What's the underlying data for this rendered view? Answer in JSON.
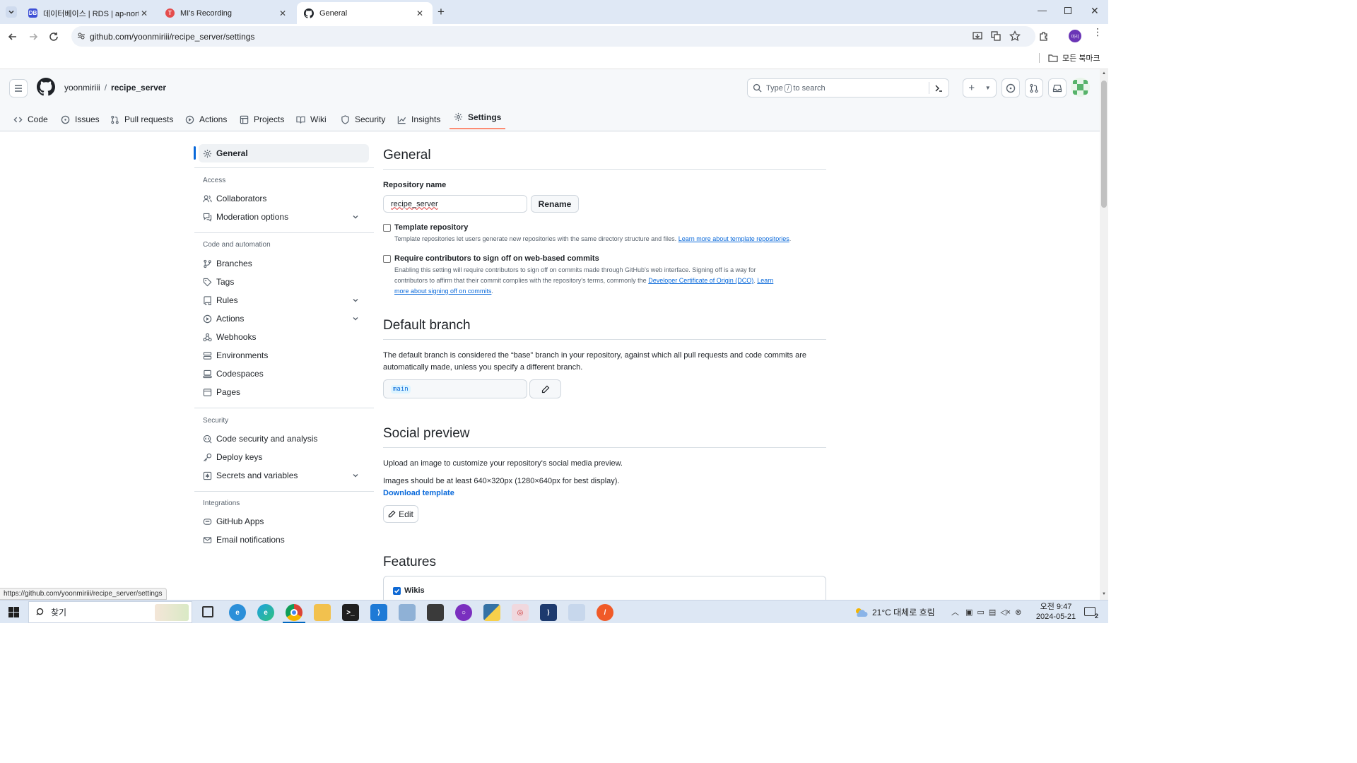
{
  "browser": {
    "tabs": [
      {
        "title": "데이터베이스 | RDS | ap-northeast",
        "active": false
      },
      {
        "title": "MI's Recording",
        "active": false
      },
      {
        "title": "General",
        "active": true
      }
    ],
    "url": "github.com/yoonmiriii/recipe_server/settings",
    "bookmarks_label": "모든 북마크",
    "profile_initials": "미리"
  },
  "github": {
    "owner": "yoonmiriii",
    "separator": "/",
    "repo": "recipe_server",
    "search_placeholder_pre": "Type",
    "search_key": "/",
    "search_placeholder_post": "to search",
    "repo_tabs": [
      "Code",
      "Issues",
      "Pull requests",
      "Actions",
      "Projects",
      "Wiki",
      "Security",
      "Insights",
      "Settings"
    ],
    "selected_tab": "Settings"
  },
  "sidebar": {
    "general": "General",
    "access_heading": "Access",
    "access_items": [
      "Collaborators",
      "Moderation options"
    ],
    "code_heading": "Code and automation",
    "code_items": [
      "Branches",
      "Tags",
      "Rules",
      "Actions",
      "Webhooks",
      "Environments",
      "Codespaces",
      "Pages"
    ],
    "security_heading": "Security",
    "security_items": [
      "Code security and analysis",
      "Deploy keys",
      "Secrets and variables"
    ],
    "integrations_heading": "Integrations",
    "integrations_items": [
      "GitHub Apps",
      "Email notifications"
    ]
  },
  "general": {
    "title": "General",
    "repo_name_label": "Repository name",
    "repo_name_value": "recipe_server",
    "rename_button": "Rename",
    "template_label": "Template repository",
    "template_note": "Template repositories let users generate new repositories with the same directory structure and files.",
    "template_link": "Learn more about template repositories",
    "signoff_label": "Require contributors to sign off on web-based commits",
    "signoff_note_1": "Enabling this setting will require contributors to sign off on commits made through GitHub's web interface. Signing off is a way for",
    "signoff_note_2": "contributors to affirm that their commit complies with the repository's terms, commonly the",
    "signoff_link_1": "Developer Certificate of Origin (DCO)",
    "signoff_link_2a": "Learn",
    "signoff_link_2b": "more about signing off on commits"
  },
  "default_branch": {
    "title": "Default branch",
    "desc_1": "The default branch is considered the “base” branch in your repository, against which all pull requests and code commits are",
    "desc_2": "automatically made, unless you specify a different branch.",
    "branch": "main"
  },
  "social_preview": {
    "title": "Social preview",
    "desc": "Upload an image to customize your repository's social media preview.",
    "size_note": "Images should be at least 640×320px (1280×640px for best display).",
    "download_link": "Download template",
    "edit_button": "Edit"
  },
  "features": {
    "title": "Features",
    "wikis_label": "Wikis",
    "wikis_checked": true
  },
  "status_url": "https://github.com/yoonmiriii/recipe_server/settings",
  "taskbar": {
    "search_label": "찾기",
    "weather": "21°C  대체로 흐림",
    "time": "오전 9:47",
    "date": "2024-05-21",
    "notification_count": "2"
  },
  "colors": {
    "accent": "#0969da",
    "tab_underline": "#fd8c73",
    "sidebar_active": "#0969da"
  }
}
